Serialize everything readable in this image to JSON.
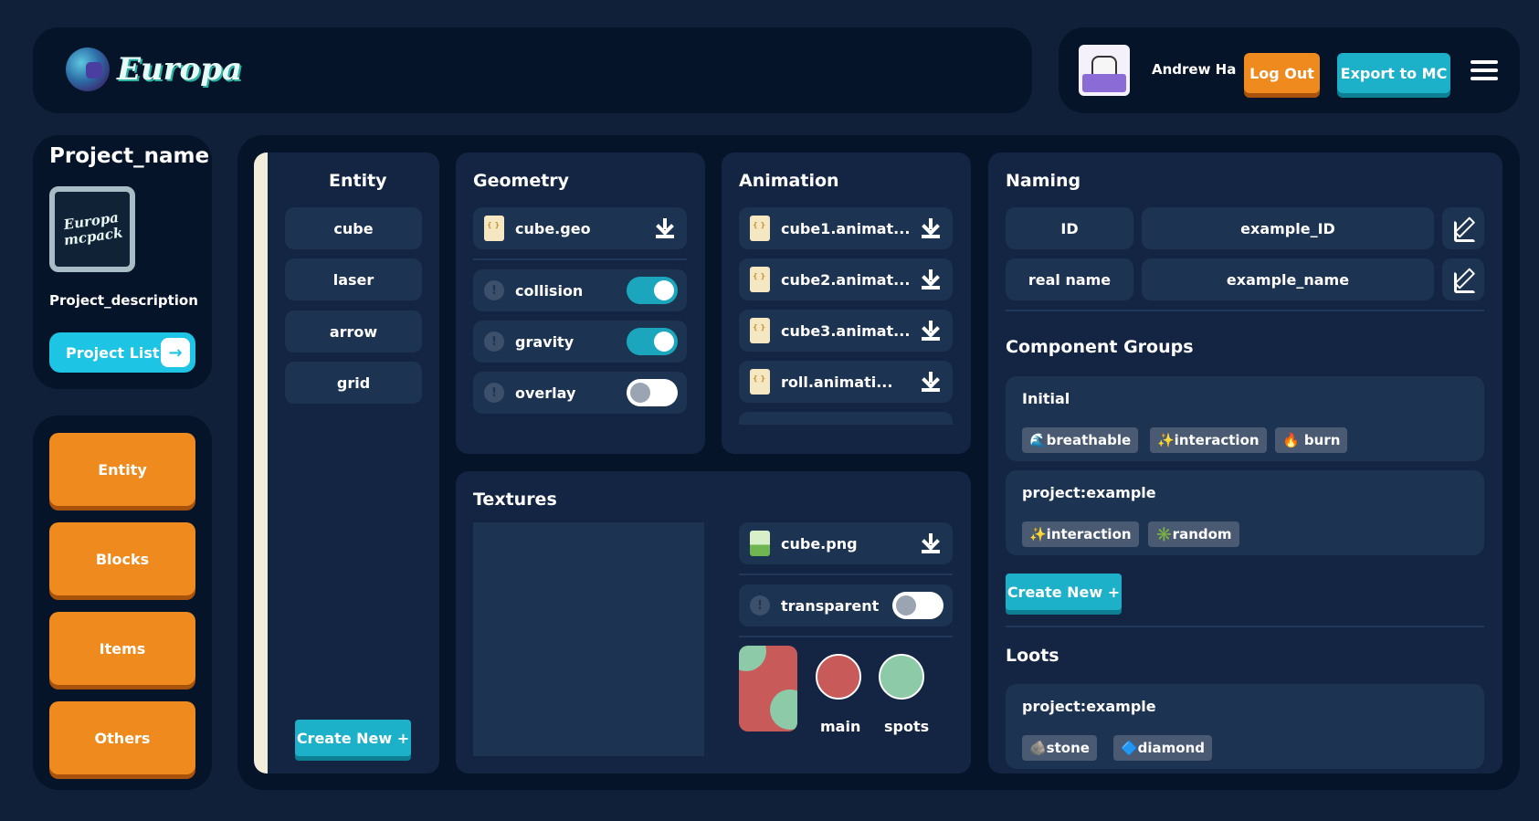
{
  "header": {
    "logo_text": "Europa",
    "username": "Andrew Ha",
    "logout_label": "Log Out",
    "export_label": "Export to MC"
  },
  "project": {
    "name": "Project_name",
    "thumb_text": "Europa mcpack",
    "description": "Project_description",
    "list_button": "Project List"
  },
  "categories": [
    "Entity",
    "Blocks",
    "Items",
    "Others"
  ],
  "entity": {
    "title": "Entity",
    "items": [
      "cube",
      "laser",
      "arrow",
      "grid"
    ],
    "create_label": "Create New +"
  },
  "geometry": {
    "title": "Geometry",
    "file": "cube.geo",
    "toggles": [
      {
        "label": "collision",
        "on": true
      },
      {
        "label": "gravity",
        "on": true
      },
      {
        "label": "overlay",
        "on": false
      }
    ]
  },
  "animation": {
    "title": "Animation",
    "files": [
      "cube1.animat...",
      "cube2.animat...",
      "cube3.animat...",
      "roll.animati..."
    ]
  },
  "textures": {
    "title": "Textures",
    "file": "cube.png",
    "transparent_label": "transparent",
    "transparent_on": false,
    "swatches": [
      {
        "label": "main",
        "color": "#c85a5a"
      },
      {
        "label": "spots",
        "color": "#8ccaa8"
      }
    ]
  },
  "naming": {
    "title": "Naming",
    "rows": [
      {
        "key": "ID",
        "value": "example_ID"
      },
      {
        "key": "real name",
        "value": "example_name"
      }
    ]
  },
  "component_groups": {
    "title": "Component Groups",
    "groups": [
      {
        "name": "Initial",
        "tags": [
          "🌊breathable",
          "✨interaction",
          "🔥 burn"
        ]
      },
      {
        "name": "project:example",
        "tags": [
          "✨interaction",
          "✳️random"
        ]
      }
    ],
    "create_label": "Create New +"
  },
  "loots": {
    "title": "Loots",
    "groups": [
      {
        "name": "project:example",
        "tags": [
          "🪨stone",
          "🔷diamond"
        ]
      }
    ]
  },
  "colors": {
    "accent_orange": "#ee8a1e",
    "accent_cyan": "#1db0c9",
    "panel": "#061429",
    "background": "#102038"
  }
}
